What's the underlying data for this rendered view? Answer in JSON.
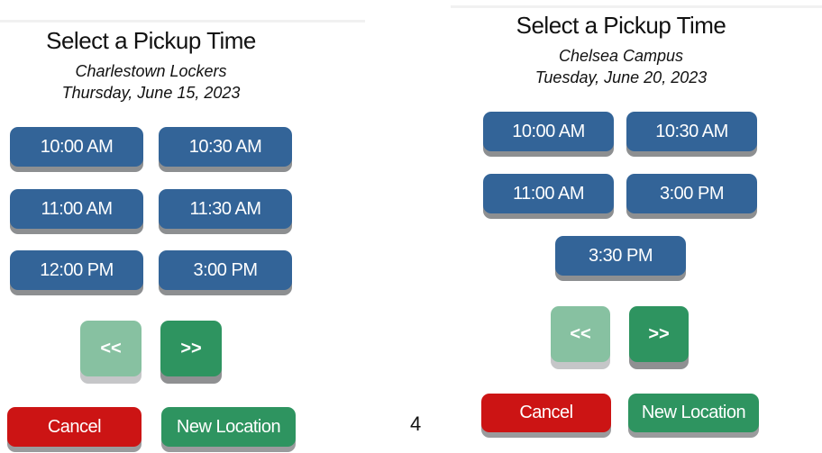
{
  "page_number": "4",
  "left": {
    "title": "Select a Pickup Time",
    "location": "Charlestown Lockers",
    "date": "Thursday, June 15, 2023",
    "times": [
      "10:00 AM",
      "10:30 AM",
      "11:00 AM",
      "11:30 AM",
      "12:00 PM",
      "3:00 PM"
    ],
    "prev_label": "<<",
    "next_label": ">>",
    "cancel_label": "Cancel",
    "new_location_label": "New Location"
  },
  "right": {
    "title": "Select a Pickup Time",
    "location": "Chelsea Campus",
    "date": "Tuesday, June 20, 2023",
    "times": [
      "10:00 AM",
      "10:30 AM",
      "11:00 AM",
      "3:00 PM",
      "3:30 PM"
    ],
    "prev_label": "<<",
    "next_label": ">>",
    "cancel_label": "Cancel",
    "new_location_label": "New Location"
  },
  "colors": {
    "time_button": "#336498",
    "nav_disabled": "#87c1a1",
    "nav_active": "#2e9460",
    "cancel": "#cc1414",
    "new_location": "#2e9460"
  }
}
